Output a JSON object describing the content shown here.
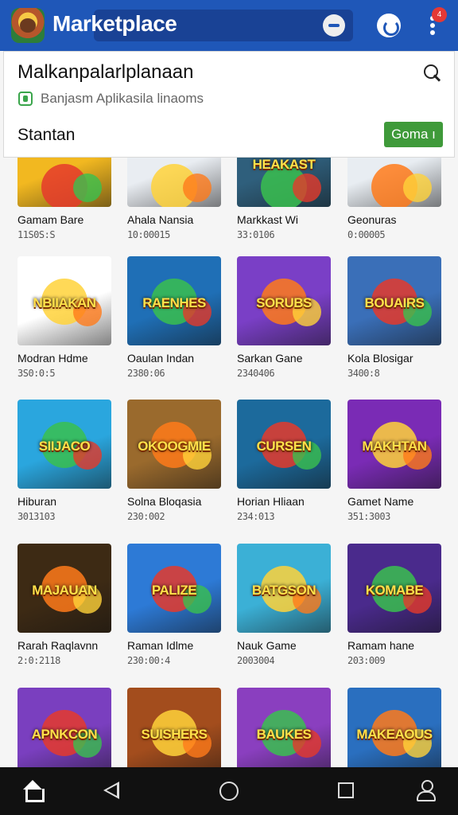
{
  "appbar": {
    "title": "Marketplace",
    "notification_count": "4",
    "colors": {
      "bar": "#1f57b8"
    },
    "icons": [
      "app-logo",
      "search-icon",
      "refresh-icon",
      "more-vert-icon"
    ]
  },
  "header": {
    "title": "Malkanpalarlplanaan",
    "subtitle": "Banjasm Aplikasila linaoms",
    "section": "Stantan",
    "button": "Goma ı",
    "colors": {
      "button": "#3f9a3a",
      "subtitle_icon": "#3aa54b"
    }
  },
  "grid": {
    "rows": [
      [
        {
          "name": "Gamam Bare",
          "meta": "11S0S:S",
          "art": ""
        },
        {
          "name": "Ahala Nansia",
          "meta": "10:00015",
          "art": ""
        },
        {
          "name": "Markkast Wi",
          "meta": "33:0106",
          "art": "HEAKAST"
        },
        {
          "name": "Geonuras",
          "meta": "0:00005",
          "art": ""
        }
      ],
      [
        {
          "name": "Modran Hdme",
          "meta": "3S0:0:5",
          "art": "NBIIAKAN"
        },
        {
          "name": "Oaulan Indan",
          "meta": "2380:06",
          "art": "RAENHES"
        },
        {
          "name": "Sarkan Gane",
          "meta": "2340406",
          "art": "SORUBS"
        },
        {
          "name": "Kola Blosigar",
          "meta": "3400:8",
          "art": "BOUAIRS"
        }
      ],
      [
        {
          "name": "Hiburan",
          "meta": "3013103",
          "art": "SIIJACO"
        },
        {
          "name": "Solna Bloqasia",
          "meta": "230:002",
          "art": "OKOOGMIE"
        },
        {
          "name": "Horian Hliaan",
          "meta": "234:013",
          "art": "CURSEN"
        },
        {
          "name": "Gamet Name",
          "meta": "351:3003",
          "art": "MAKHTAN"
        }
      ],
      [
        {
          "name": "Rarah Raqlavnn",
          "meta": "2:0:2118",
          "art": "MAJAUAN"
        },
        {
          "name": "Raman Idlme",
          "meta": "230:00:4",
          "art": "PALIZE"
        },
        {
          "name": "Nauk Game",
          "meta": "2003004",
          "art": "BATGSON"
        },
        {
          "name": "Ramam hane",
          "meta": "203:009",
          "art": "KOMABE"
        }
      ],
      [
        {
          "name": "",
          "meta": "",
          "art": "APNKCON"
        },
        {
          "name": "",
          "meta": "",
          "art": "SUISHERS"
        },
        {
          "name": "",
          "meta": "",
          "art": "BAUKES"
        },
        {
          "name": "",
          "meta": "",
          "art": "MAKEAOUS"
        }
      ]
    ],
    "palette": [
      [
        "#f2b820",
        "#e9edf2",
        "#2f5f7c",
        "#e8edf2"
      ],
      [
        "#ffffff",
        "#1f6fb6",
        "#7a3fc6",
        "#3a6fb8"
      ],
      [
        "#2aa6de",
        "#9a6a2d",
        "#1c6a9c",
        "#7a2bb5"
      ],
      [
        "#3d2a14",
        "#2d7ad6",
        "#3bb0d6",
        "#4a2a8c"
      ],
      [
        "#7a3fbf",
        "#a34d1d",
        "#8a3fbf",
        "#2a6fbf"
      ]
    ]
  },
  "navbar": {
    "icons": [
      "home-icon",
      "back-icon",
      "home-circle-icon",
      "recents-icon",
      "account-icon"
    ]
  }
}
